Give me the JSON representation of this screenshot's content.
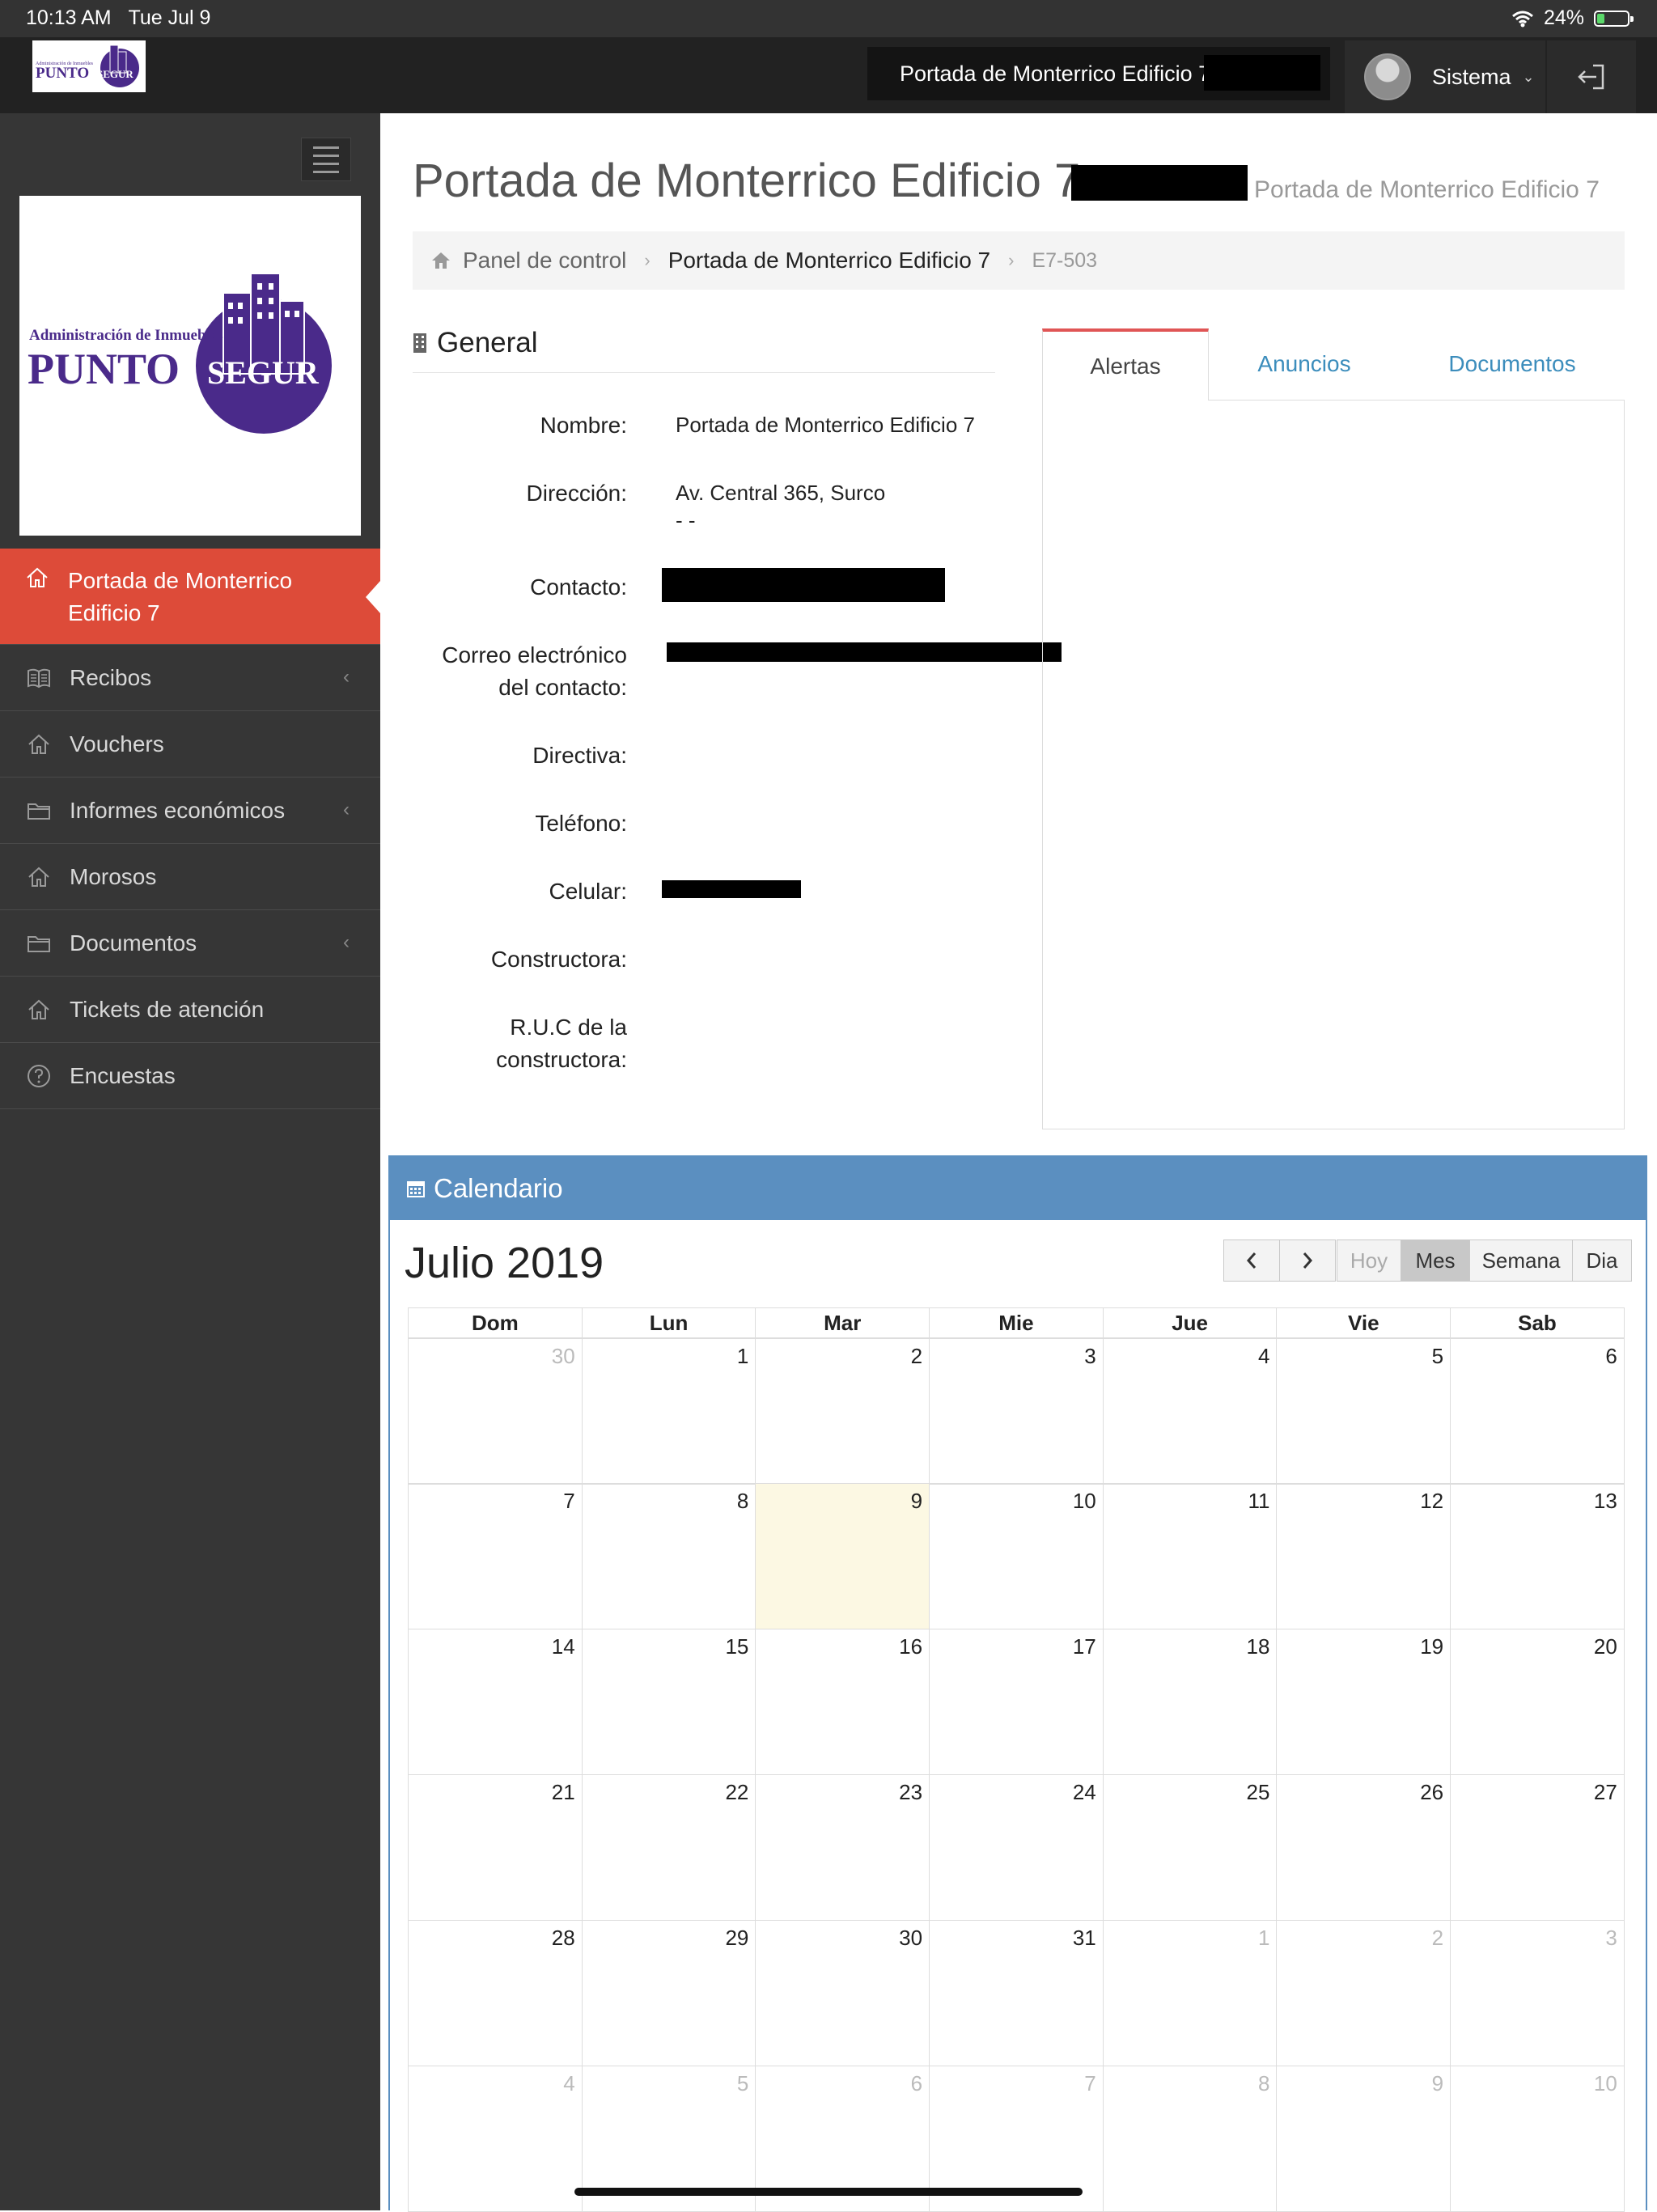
{
  "status_bar": {
    "time": "10:13 AM",
    "date": "Tue Jul 9",
    "battery": "24%",
    "battery_level": 0.24
  },
  "topnav": {
    "building": "Portada de Monterrico Edificio 7",
    "user": "Sistema"
  },
  "logo": {
    "top_text": "Administración de Inmuebles",
    "brand_a": "PUNTO",
    "brand_b": "SEGUR"
  },
  "sidebar": {
    "items": [
      {
        "label": "Portada de Monterrico Edificio 7",
        "icon": "home-icon",
        "active": true
      },
      {
        "label": "Recibos",
        "icon": "book-icon",
        "has_sub": true
      },
      {
        "label": "Vouchers",
        "icon": "home-icon"
      },
      {
        "label": "Informes económicos",
        "icon": "folder-icon",
        "has_sub": true
      },
      {
        "label": "Morosos",
        "icon": "home-icon"
      },
      {
        "label": "Documentos",
        "icon": "folder-icon",
        "has_sub": true
      },
      {
        "label": "Tickets de atención",
        "icon": "home-icon"
      },
      {
        "label": "Encuestas",
        "icon": "question-circle-icon"
      }
    ]
  },
  "page": {
    "title": "Portada de Monterrico Edificio 7",
    "subtitle": "Portada de Monterrico Edificio 7",
    "breadcrumb": [
      "Panel de control",
      "Portada de Monterrico Edificio 7",
      "E7-503"
    ]
  },
  "general": {
    "heading": "General",
    "fields": {
      "nombre": {
        "label": "Nombre:",
        "value": "Portada de Monterrico Edificio 7"
      },
      "direccion": {
        "label": "Dirección:",
        "value": "Av. Central 365, Surco",
        "value2": "- -"
      },
      "contacto": {
        "label": "Contacto:"
      },
      "correo": {
        "label1": "Correo electrónico",
        "label2": "del contacto:"
      },
      "directiva": {
        "label": "Directiva:"
      },
      "telefono": {
        "label": "Teléfono:"
      },
      "celular": {
        "label": "Celular:"
      },
      "constructora": {
        "label": "Constructora:"
      },
      "ruc": {
        "label1": "R.U.C de la",
        "label2": "constructora:"
      }
    }
  },
  "tabs": [
    "Alertas",
    "Anuncios",
    "Documentos"
  ],
  "calendar": {
    "heading": "Calendario",
    "month": "Julio 2019",
    "buttons": {
      "today": "Hoy",
      "month": "Mes",
      "week": "Semana",
      "day": "Dia"
    },
    "days_of_week": [
      "Dom",
      "Lun",
      "Mar",
      "Mie",
      "Jue",
      "Vie",
      "Sab"
    ],
    "weeks": [
      [
        "30",
        "1",
        "2",
        "3",
        "4",
        "5",
        "6"
      ],
      [
        "7",
        "8",
        "9",
        "10",
        "11",
        "12",
        "13"
      ],
      [
        "14",
        "15",
        "16",
        "17",
        "18",
        "19",
        "20"
      ],
      [
        "21",
        "22",
        "23",
        "24",
        "25",
        "26",
        "27"
      ],
      [
        "28",
        "29",
        "30",
        "31",
        "1",
        "2",
        "3"
      ],
      [
        "4",
        "5",
        "6",
        "7",
        "8",
        "9",
        "10"
      ]
    ],
    "other_month": [
      [
        0,
        0
      ],
      [
        4,
        4
      ],
      [
        4,
        5
      ],
      [
        4,
        6
      ],
      [
        5,
        0
      ],
      [
        5,
        1
      ],
      [
        5,
        2
      ],
      [
        5,
        3
      ],
      [
        5,
        4
      ],
      [
        5,
        5
      ],
      [
        5,
        6
      ]
    ],
    "today": [
      1,
      2
    ]
  },
  "colors": {
    "active": "#dd4b39",
    "calendar_header": "#5b8fc0",
    "link": "#3c8dbc",
    "sidebar": "#363636"
  }
}
